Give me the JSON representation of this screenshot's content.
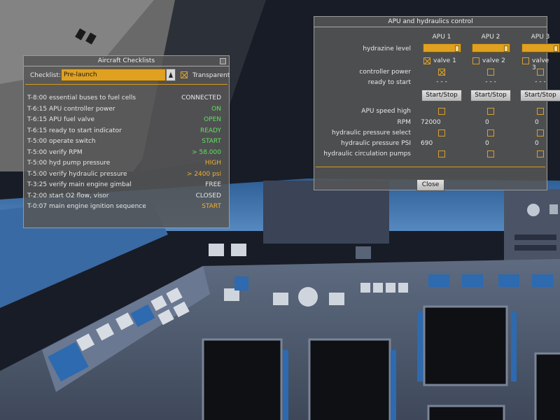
{
  "checklist_dialog": {
    "title": "Aircraft Checklists",
    "checklist_label": "Checklist:",
    "selected_checklist": "Pre-launch",
    "transparent_label": "Transparent",
    "transparent_checked": true,
    "items": [
      {
        "task": "T-8:00 essential buses to fuel cells",
        "value": "CONNECTED",
        "color": "#e8e8e8"
      },
      {
        "task": "T-6:15 APU controller power",
        "value": "ON",
        "color": "#5fe05f"
      },
      {
        "task": "T-6:15 APU fuel valve",
        "value": "OPEN",
        "color": "#5fe05f"
      },
      {
        "task": "T-6:15 ready to start indicator",
        "value": "READY",
        "color": "#5fe05f"
      },
      {
        "task": "T-5:00 operate switch",
        "value": "START",
        "color": "#5fe05f"
      },
      {
        "task": "T-5:00 verify RPM",
        "value": "> 58.000",
        "color": "#5fe05f"
      },
      {
        "task": "T-5:00 hyd pump pressure",
        "value": "HIGH",
        "color": "#f0b030"
      },
      {
        "task": "T-5:00 verify hydraulic pressure",
        "value": "> 2400 psi",
        "color": "#f0b030"
      },
      {
        "task": "T-3:25 verify main engine gimbal",
        "value": "FREE",
        "color": "#e8e8e8"
      },
      {
        "task": "T-2:00 start O2 flow, visor",
        "value": "CLOSED",
        "color": "#e8e8e8"
      },
      {
        "task": "T-0:07 main engine ignition sequence",
        "value": "START",
        "color": "#f0b030"
      }
    ]
  },
  "apu_dialog": {
    "title": "APU and hydraulics control",
    "columns": [
      "APU 1",
      "APU 2",
      "APU 3"
    ],
    "hydrazine_label": "hydrazine level",
    "hydrazine_levels": [
      1.0,
      1.0,
      1.0
    ],
    "valves": [
      {
        "label": "valve 1",
        "checked": true
      },
      {
        "label": "valve 2",
        "checked": false
      },
      {
        "label": "valve 3",
        "checked": false
      }
    ],
    "controller_power_label": "controller power",
    "controller_power": [
      true,
      false,
      false
    ],
    "ready_label": "ready to start",
    "ready_values": [
      "- - -",
      "- - -",
      "- - -"
    ],
    "start_stop_label": "Start/Stop",
    "speed_high_label": "APU speed high",
    "speed_high": [
      false,
      false,
      false
    ],
    "rpm_label": "RPM",
    "rpm_values": [
      "72000",
      "0",
      "0"
    ],
    "pressure_select_label": "hydraulic pressure select",
    "pressure_select": [
      false,
      false,
      false
    ],
    "pressure_psi_label": "hydraulic pressure PSI",
    "pressure_psi_values": [
      "690",
      "0",
      "0"
    ],
    "circ_pumps_label": "hydraulic circulation pumps",
    "circ_pumps": [
      false,
      false,
      false
    ],
    "close_label": "Close"
  }
}
